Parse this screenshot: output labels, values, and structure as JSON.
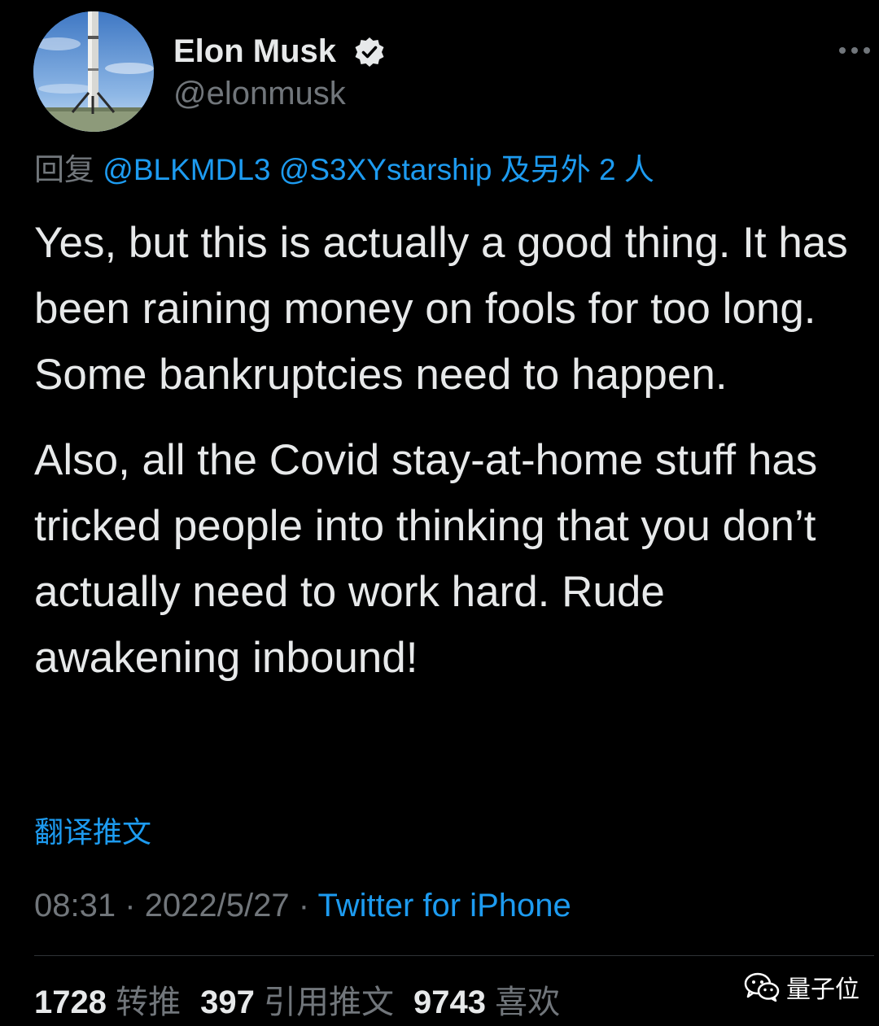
{
  "author": {
    "name": "Elon Musk",
    "handle": "@elonmusk",
    "verified_icon": "verified-badge-icon",
    "avatar": "rocket-booster-on-launch-pad"
  },
  "reply": {
    "prefix": "回复",
    "mention1": "@BLKMDL3",
    "mention2": "@S3XYstarship",
    "suffix": "及另外 2 人"
  },
  "tweet": {
    "paragraph1": "Yes, but this is actually a good thing. It has been raining money on fools for too long. Some bankruptcies need to happen.",
    "paragraph2": "Also, all the Covid stay-at-home stuff has tricked people into thinking that you don’t actually need to work hard. Rude awakening inbound!"
  },
  "translate_link": "翻译推文",
  "meta": {
    "time": "08:31",
    "separator": "·",
    "date": "2022/5/27",
    "source": "Twitter for iPhone"
  },
  "stats": {
    "retweets": "1728",
    "retweets_label": "转推",
    "quotes": "397",
    "quotes_label": "引用推文",
    "likes": "9743",
    "likes_label": "喜欢"
  },
  "watermark": {
    "text": "量子位",
    "icon": "wechat-icon"
  },
  "colors": {
    "background": "#000000",
    "text": "#e7e9ea",
    "muted": "#71767b",
    "link": "#1d9bf0"
  }
}
